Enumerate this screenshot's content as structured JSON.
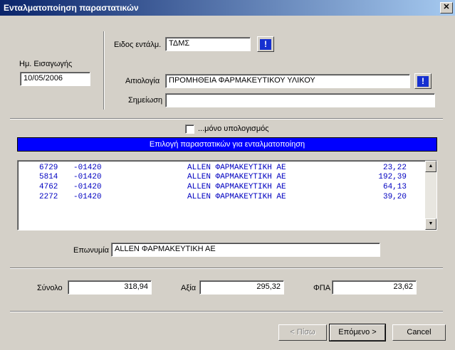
{
  "window": {
    "title": "Ενταλματοποίηση παραστατικών",
    "close_glyph": "✕"
  },
  "entry_date": {
    "label": "Ημ. Εισαγωγής",
    "value": "10/05/2006"
  },
  "mandate_type": {
    "label": "Ειδος εντάλμ.",
    "value": "ΤΔΜΣ",
    "info_glyph": "!"
  },
  "justification": {
    "label": "Αιτιολογία",
    "value": "ΠΡΟΜΗΘΕΙΑ ΦΑΡΜΑΚΕΥΤΙΚΟΥ ΥΛΙΚΟΥ",
    "info_glyph": "!"
  },
  "note": {
    "label": "Σημείωση",
    "value": ""
  },
  "calc_only": {
    "label": "...μόνο υπολογισμός",
    "checked": false
  },
  "selection_banner": "Επιλογή παραστατικών για ενταλματοποίηση",
  "documents": [
    {
      "number": "6729",
      "code": "-01420",
      "name": "ALLEN ΦΑΡΜΑΚΕΥΤΙΚΗ ΑΕ",
      "amount": "23,22"
    },
    {
      "number": "5814",
      "code": "-01420",
      "name": "ALLEN ΦΑΡΜΑΚΕΥΤΙΚΗ ΑΕ",
      "amount": "192,39"
    },
    {
      "number": "4762",
      "code": "-01420",
      "name": "ALLEN ΦΑΡΜΑΚΕΥΤΙΚΗ ΑΕ",
      "amount": "64,13"
    },
    {
      "number": "2272",
      "code": "-01420",
      "name": "ALLEN ΦΑΡΜΑΚΕΥΤΙΚΗ ΑΕ",
      "amount": "39,20"
    }
  ],
  "scroll": {
    "up_glyph": "▲",
    "down_glyph": "▼"
  },
  "company": {
    "label": "Επωνυμία",
    "value": "ALLEN ΦΑΡΜΑΚΕΥΤΙΚΗ ΑΕ"
  },
  "totals": {
    "total_label": "Σύνολο",
    "total_value": "318,94",
    "value_label": "Αξία",
    "value_value": "295,32",
    "vat_label": "ΦΠΑ",
    "vat_value": "23,62"
  },
  "buttons": {
    "back": "< Πίσω",
    "next": "Επόμενο >",
    "cancel": "Cancel"
  }
}
